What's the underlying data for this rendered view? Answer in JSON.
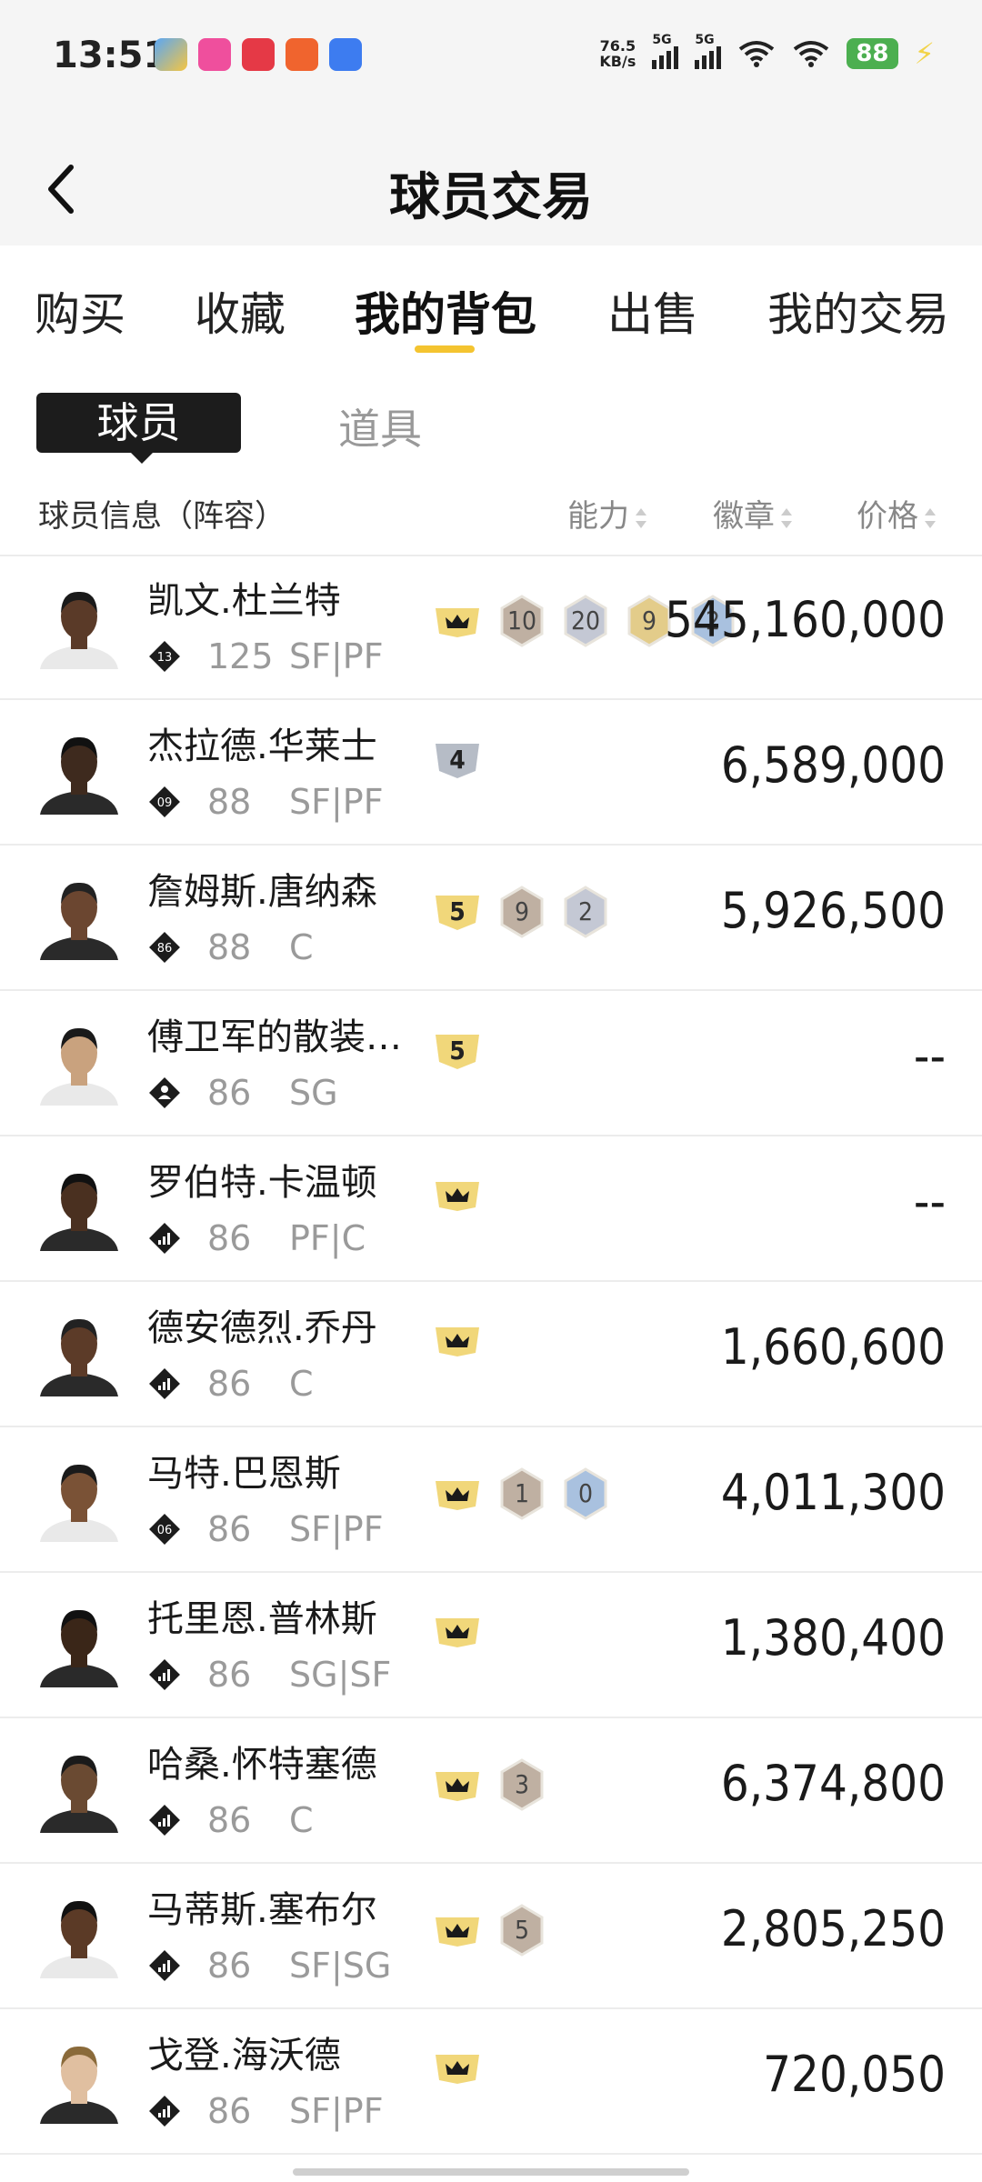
{
  "status_bar": {
    "time": "13:51",
    "net_speed_value": "76.5",
    "net_speed_unit": "KB/s",
    "signal_labels": [
      "5G",
      "5G"
    ],
    "battery": "88",
    "app_icons": [
      "blue-app-icon",
      "pink-app-icon",
      "red-app-icon",
      "orange-app-icon",
      "blue-hand-app-icon"
    ]
  },
  "header": {
    "title": "球员交易",
    "back_icon": "chevron-left-icon"
  },
  "tabs": [
    {
      "label": "购买",
      "active": false
    },
    {
      "label": "收藏",
      "active": false
    },
    {
      "label": "我的背包",
      "active": true
    },
    {
      "label": "出售",
      "active": false
    },
    {
      "label": "我的交易",
      "active": false
    }
  ],
  "subtabs": {
    "active": "球员",
    "inactive": "道具"
  },
  "columns": {
    "info": "球员信息（阵容）",
    "ability": "能力",
    "badges": "徽章",
    "price": "价格"
  },
  "colors": {
    "accent": "#f4c430",
    "dark": "#1c1c1c",
    "muted": "#9a9a9a"
  },
  "players": [
    {
      "name": "凯文.杜兰特",
      "team_badge": "13",
      "ovr": "125",
      "positions": "SF|PF",
      "crown": true,
      "level": "",
      "chips": [
        "10",
        "20",
        "9",
        "2"
      ],
      "price": "545,160,000"
    },
    {
      "name": "杰拉德.华莱士",
      "team_badge": "09",
      "ovr": "88",
      "positions": "SF|PF",
      "crown": false,
      "level": "4",
      "chips": [],
      "price": "6,589,000"
    },
    {
      "name": "詹姆斯.唐纳森",
      "team_badge": "86",
      "ovr": "88",
      "positions": "C",
      "crown": false,
      "level": "5",
      "chips": [
        "9",
        "2"
      ],
      "price": "5,926,500"
    },
    {
      "name": "傅卫军的散装…",
      "team_badge": "person",
      "ovr": "86",
      "positions": "SG",
      "crown": false,
      "level": "5",
      "chips": [],
      "price": "--"
    },
    {
      "name": "罗伯特.卡温顿",
      "team_badge": "signal",
      "ovr": "86",
      "positions": "PF|C",
      "crown": true,
      "level": "",
      "chips": [],
      "price": "--"
    },
    {
      "name": "德安德烈.乔丹",
      "team_badge": "signal",
      "ovr": "86",
      "positions": "C",
      "crown": true,
      "level": "",
      "chips": [],
      "price": "1,660,600"
    },
    {
      "name": "马特.巴恩斯",
      "team_badge": "06",
      "ovr": "86",
      "positions": "SF|PF",
      "crown": true,
      "level": "",
      "chips": [
        "1",
        "0"
      ],
      "price": "4,011,300"
    },
    {
      "name": "托里恩.普林斯",
      "team_badge": "signal",
      "ovr": "86",
      "positions": "SG|SF",
      "crown": true,
      "level": "",
      "chips": [],
      "price": "1,380,400"
    },
    {
      "name": "哈桑.怀特塞德",
      "team_badge": "signal",
      "ovr": "86",
      "positions": "C",
      "crown": true,
      "level": "",
      "chips": [
        "3"
      ],
      "price": "6,374,800"
    },
    {
      "name": "马蒂斯.塞布尔",
      "team_badge": "signal",
      "ovr": "86",
      "positions": "SF|SG",
      "crown": true,
      "level": "",
      "chips": [
        "5"
      ],
      "price": "2,805,250"
    },
    {
      "name": "戈登.海沃德",
      "team_badge": "signal",
      "ovr": "86",
      "positions": "SF|PF",
      "crown": true,
      "level": "",
      "chips": [],
      "price": "720,050"
    }
  ]
}
